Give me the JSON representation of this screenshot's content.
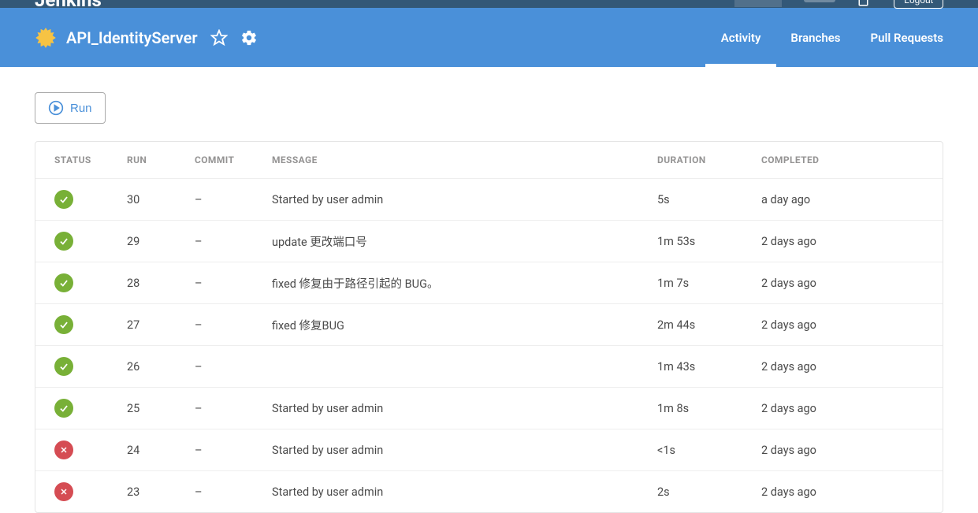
{
  "brand": "Jenkins",
  "logout_label": "Logout",
  "project": {
    "name": "API_IdentityServer"
  },
  "tabs": {
    "activity": "Activity",
    "branches": "Branches",
    "pull_requests": "Pull Requests"
  },
  "run_button": "Run",
  "table": {
    "headers": {
      "status": "STATUS",
      "run": "RUN",
      "commit": "COMMIT",
      "message": "MESSAGE",
      "duration": "DURATION",
      "completed": "COMPLETED"
    },
    "rows": [
      {
        "status": "success",
        "run": "30",
        "commit": "–",
        "message": "Started by user admin",
        "duration": "5s",
        "completed": "a day ago"
      },
      {
        "status": "success",
        "run": "29",
        "commit": "–",
        "message": "update 更改端口号",
        "duration": "1m 53s",
        "completed": "2 days ago"
      },
      {
        "status": "success",
        "run": "28",
        "commit": "–",
        "message": "fixed 修复由于路径引起的 BUG。",
        "duration": "1m 7s",
        "completed": "2 days ago"
      },
      {
        "status": "success",
        "run": "27",
        "commit": "–",
        "message": "fixed 修复BUG",
        "duration": "2m 44s",
        "completed": "2 days ago"
      },
      {
        "status": "success",
        "run": "26",
        "commit": "–",
        "message": "",
        "duration": "1m 43s",
        "completed": "2 days ago"
      },
      {
        "status": "success",
        "run": "25",
        "commit": "–",
        "message": "Started by user admin",
        "duration": "1m 8s",
        "completed": "2 days ago"
      },
      {
        "status": "failed",
        "run": "24",
        "commit": "–",
        "message": "Started by user admin",
        "duration": "<1s",
        "completed": "2 days ago"
      },
      {
        "status": "failed",
        "run": "23",
        "commit": "–",
        "message": "Started by user admin",
        "duration": "2s",
        "completed": "2 days ago"
      }
    ]
  }
}
